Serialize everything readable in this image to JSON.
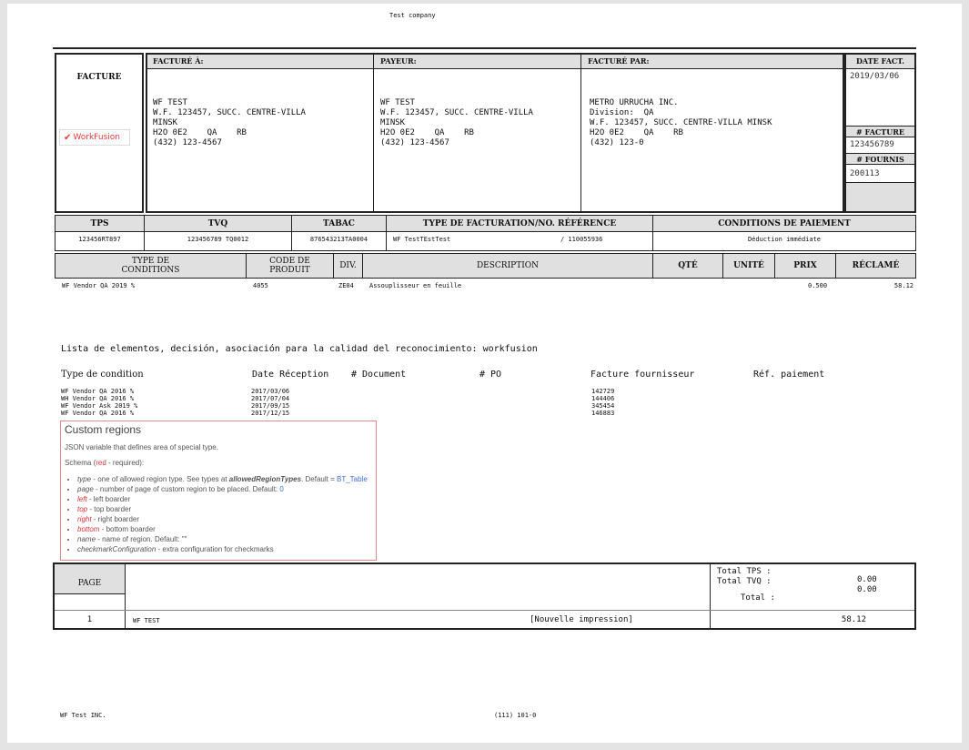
{
  "header_company": "Test company",
  "invoice_block": {
    "facture_label": "FACTURE",
    "logo_text": "WorkFusion"
  },
  "bill_to": {
    "header": "FACTURÉ À:",
    "lines": [
      "WF TEST",
      "W.F. 123457, SUCC. CENTRE-VILLA",
      "MINSK",
      "H2O 0E2    QA    RB",
      "",
      "(432) 123-4567"
    ]
  },
  "payer": {
    "header": "PAYEUR:",
    "lines": [
      "WF TEST",
      "W.F. 123457, SUCC. CENTRE-VILLA",
      "MINSK",
      "H2O 0E2    QA    RB",
      "",
      "(432) 123-4567"
    ]
  },
  "billed_by": {
    "header": "FACTURÉ PAR:",
    "lines": [
      "METRO URRUCHA INC.",
      "Division:  QA",
      "W.F. 123457, SUCC. CENTRE-VILLA MINSK",
      "H2O 0E2    QA    RB",
      "",
      "(432) 123-0"
    ]
  },
  "right_panel": {
    "date_label": "DATE FACT.",
    "date_value": "2019/03/06",
    "invoice_no_label": "# FACTURE",
    "invoice_no_value": "123456789",
    "supplier_no_label": "# FOURNIS",
    "supplier_no_value": "200113"
  },
  "tax_row": {
    "headers": [
      "TPS",
      "TVQ",
      "TABAC",
      "TYPE DE FACTURATION/NO. RÉFÉRENCE",
      "CONDITIONS DE PAIEMENT"
    ],
    "values": [
      "123456RT897",
      "123456789 TQ0012",
      "876543213TA0004",
      "WF TestTEstTest",
      "/ 110055936",
      "Déduction immédiate"
    ]
  },
  "items_table": {
    "headers": [
      "TYPE DE\nCONDITIONS",
      "CODE DE\nPRODUIT",
      "DIV.",
      "DESCRIPTION",
      "QTÉ",
      "UNITÉ",
      "PRIX",
      "RÉCLAMÉ"
    ],
    "rows": [
      {
        "type": "WF Vendor QA 2019 %",
        "code": "4055",
        "div": "ZE04",
        "description": "Assouplisseur en feuille",
        "qty": "",
        "unit": "",
        "price": "0.500",
        "claimed": "58.12"
      }
    ]
  },
  "section_title": "Lista de elementos, decisión, asociación para la calidad del reconocimiento: workfusion",
  "conditions_table": {
    "headers": [
      "Type de condition",
      "Date Réception",
      "# Document",
      "# PO",
      "Facture fournisseur",
      "Réf. paiement"
    ],
    "rows": [
      {
        "type": "WF Vendor QA 2016 %",
        "date": "2017/03/06",
        "invoice": "142729"
      },
      {
        "type": "WH Vendor QA 2016 %",
        "date": "2017/07/04",
        "invoice": "144406"
      },
      {
        "type": "WF Vendor Ask 2019 %",
        "date": "2017/09/15",
        "invoice": "345454"
      },
      {
        "type": "WF Vendor QA 2016 %",
        "date": "2017/12/15",
        "invoice": "146883"
      }
    ]
  },
  "custom_regions": {
    "title": "Custom regions",
    "description": "JSON variable that defines area of special type.",
    "schema_prefix": "Schema (",
    "schema_red": "red",
    "schema_suffix": " - required):",
    "items": [
      {
        "name": "type",
        "text": " - one of allowed region type. See types at ",
        "bold": "allowedRegionTypes",
        "tail": ". Default = ",
        "link": "BT_Table",
        "required": false
      },
      {
        "name": "page",
        "text": " - number of page of custom region to be placed. Default: ",
        "link": "0",
        "required": false
      },
      {
        "name": "left",
        "text": " - left boarder",
        "required": true
      },
      {
        "name": "top",
        "text": " - top boarder",
        "required": true
      },
      {
        "name": "right",
        "text": " - right boarder",
        "required": true
      },
      {
        "name": "bottom",
        "text": " - bottom boarder",
        "required": true
      },
      {
        "name": "name",
        "text": " - name of region. Default: \"\"",
        "required": false
      },
      {
        "name": "checkmarkConfiguration",
        "text": " - extra configuration for checkmarks",
        "required": false
      }
    ]
  },
  "footer_box": {
    "page_label": "PAGE",
    "page_number": "1",
    "footer_name": "WF TEST",
    "reprint": "[Nouvelle impression]",
    "total_tps_label": "Total TPS :",
    "total_tvq_label": "Total TVQ :",
    "total_label": "Total :",
    "total_tps_value": "0.00",
    "total_tvq_value": "0.00",
    "total_value": "58.12"
  },
  "page_footer": {
    "left": "WF Test INC.",
    "center": "(111) 101-0"
  }
}
